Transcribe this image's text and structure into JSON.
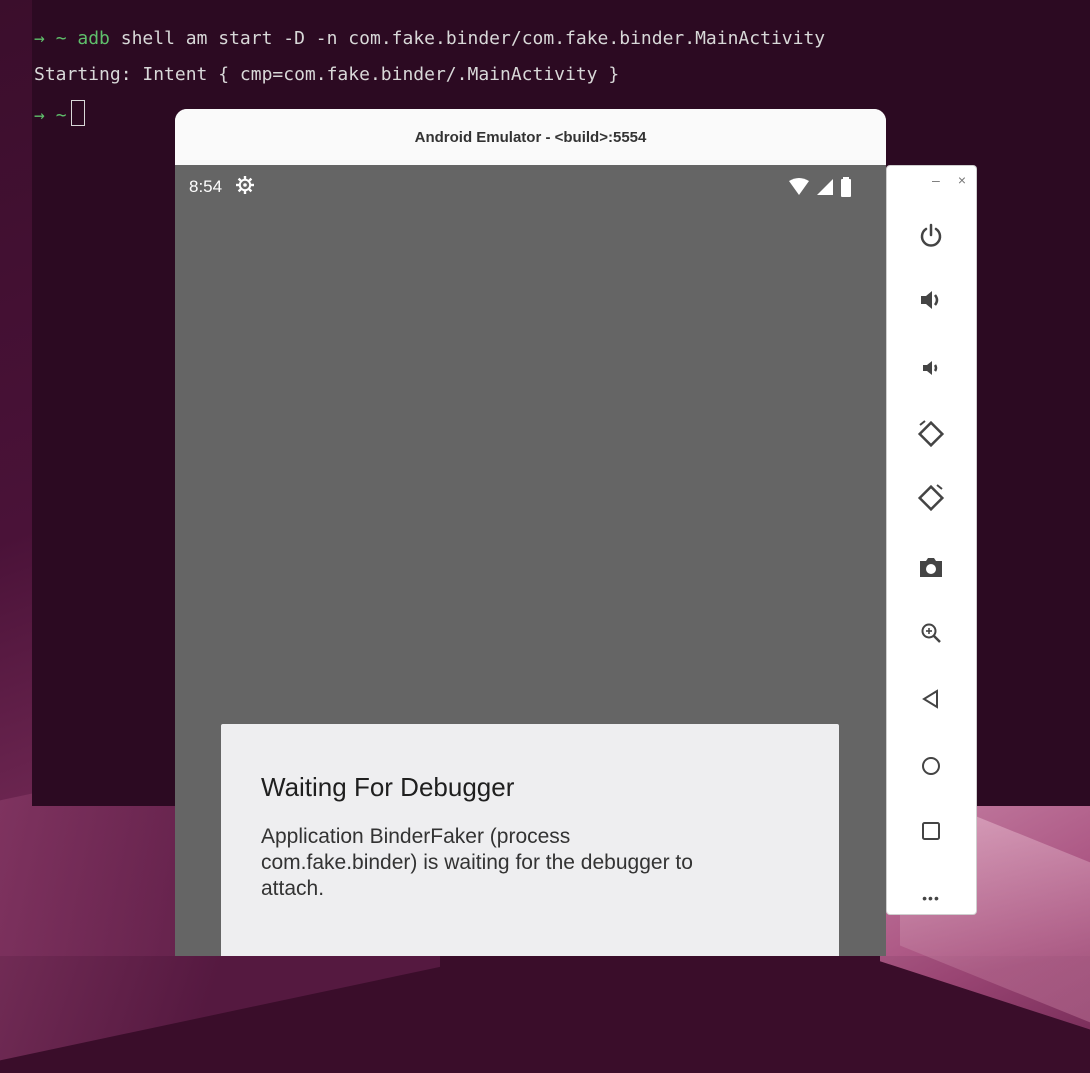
{
  "terminal": {
    "line1": {
      "arrow": "→",
      "tilde": "~",
      "cmd": "adb",
      "rest": " shell am start -D -n com.fake.binder/com.fake.binder.MainActivity"
    },
    "line2": "Starting: Intent { cmp=com.fake.binder/.MainActivity }",
    "line3": {
      "arrow": "→",
      "tilde": "~"
    }
  },
  "emulator": {
    "title": "Android Emulator - <build>:5554",
    "statusbar": {
      "time": "8:54",
      "gear_icon": "settings-icon",
      "icons": [
        "wifi-icon",
        "signal-icon",
        "battery-icon"
      ]
    },
    "dialog": {
      "title": "Waiting For Debugger",
      "body": "Application BinderFaker (process com.fake.binder) is waiting for the debugger to attach."
    }
  },
  "toolbar": {
    "minimize": "–",
    "close": "×",
    "buttons": [
      "power-icon",
      "volume-up-icon",
      "volume-down-icon",
      "rotate-left-icon",
      "rotate-right-icon",
      "camera-icon",
      "zoom-icon",
      "back-icon",
      "home-icon",
      "overview-icon",
      "more-icon"
    ],
    "more_label": "•••"
  }
}
